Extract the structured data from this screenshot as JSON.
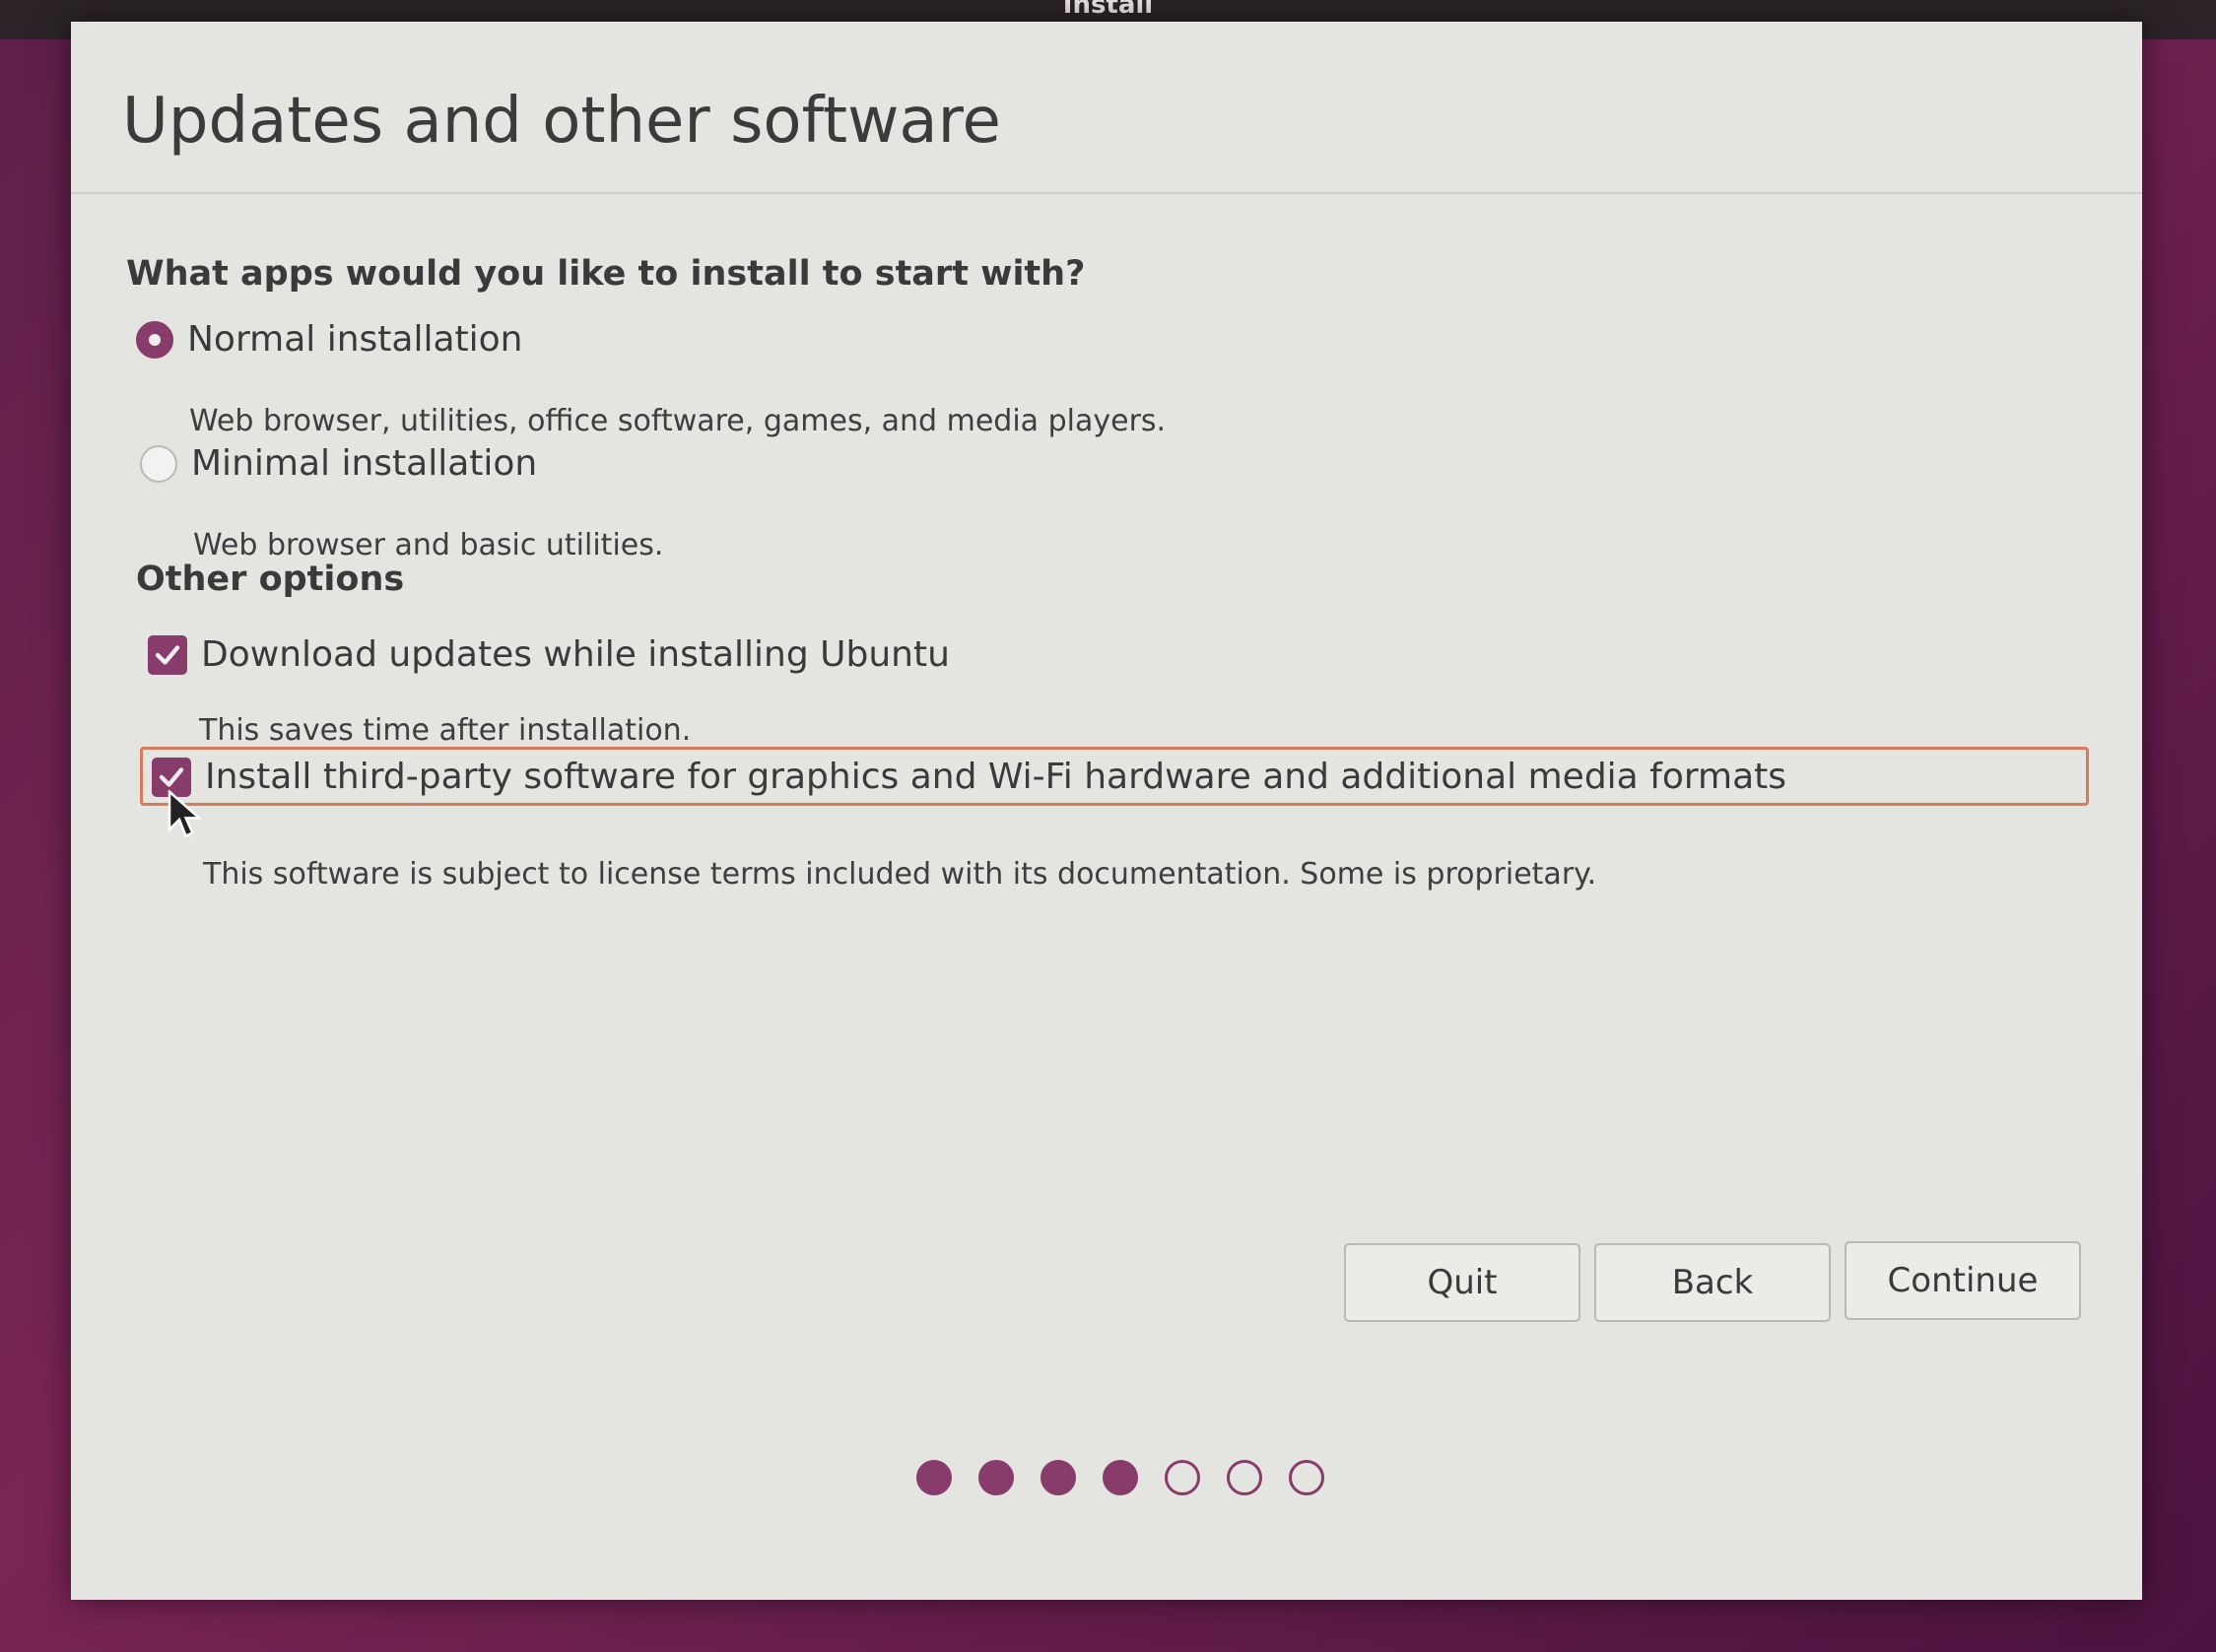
{
  "top_bar": {
    "title": "Install"
  },
  "header": {
    "title": "Updates and other software"
  },
  "question": "What apps would you like to install to start with?",
  "install_options": [
    {
      "label": "Normal installation",
      "description": "Web browser, utilities, office software, games, and media players.",
      "selected": true
    },
    {
      "label": "Minimal installation",
      "description": "Web browser and basic utilities.",
      "selected": false
    }
  ],
  "other_options": {
    "title": "Other options",
    "items": [
      {
        "label": "Download updates while installing Ubuntu",
        "description": "This saves time after installation.",
        "checked": true
      },
      {
        "label": "Install third-party software for graphics and Wi-Fi hardware and additional media formats",
        "description": "This software is subject to license terms included with its documentation. Some is proprietary.",
        "checked": true
      }
    ]
  },
  "buttons": {
    "quit": "Quit",
    "back": "Back",
    "continue": "Continue"
  },
  "progress": {
    "total_steps": 7,
    "completed_steps": 4
  },
  "colors": {
    "accent": "#873c6b",
    "focus": "#d87a5a"
  },
  "icons": {
    "checkmark": "check-icon",
    "cursor": "mouse-pointer-icon"
  }
}
